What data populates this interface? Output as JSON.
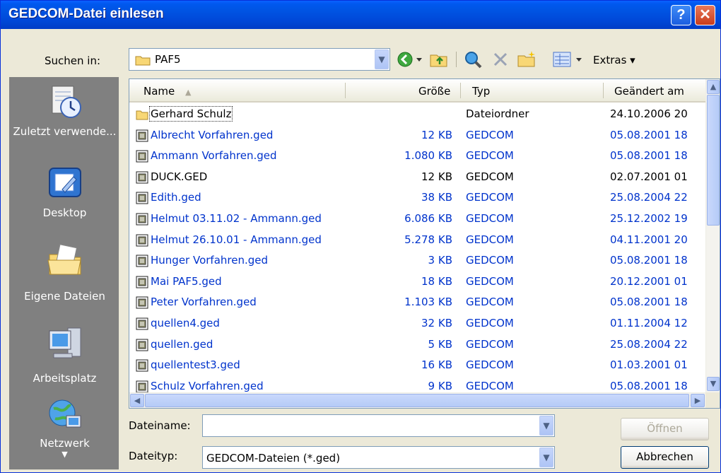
{
  "window": {
    "title": "GEDCOM-Datei einlesen",
    "help_glyph": "?",
    "close_glyph": "✕"
  },
  "lookin": {
    "label": "Suchen in:",
    "value": "PAF5"
  },
  "toolbar": {
    "extras_label": "Extras ▾"
  },
  "places": [
    {
      "label": "Zuletzt verwende...",
      "icon": "recent-documents-icon"
    },
    {
      "label": "Desktop",
      "icon": "desktop-icon"
    },
    {
      "label": "Eigene Dateien",
      "icon": "my-documents-icon"
    },
    {
      "label": "Arbeitsplatz",
      "icon": "my-computer-icon"
    },
    {
      "label": "Netzwerk",
      "icon": "network-icon"
    }
  ],
  "columns": {
    "name": "Name",
    "size": "Größe",
    "type": "Typ",
    "modified": "Geändert am"
  },
  "files": [
    {
      "name": "Gerhard Schulz",
      "size": "",
      "type": "Dateiordner",
      "modified": "24.10.2006 20",
      "kind": "folder",
      "color": "black"
    },
    {
      "name": "Albrecht Vorfahren.ged",
      "size": "12 KB",
      "type": "GEDCOM",
      "modified": "05.08.2001 18",
      "kind": "file",
      "color": "blue"
    },
    {
      "name": "Ammann Vorfahren.ged",
      "size": "1.080 KB",
      "type": "GEDCOM",
      "modified": "05.08.2001 18",
      "kind": "file",
      "color": "blue"
    },
    {
      "name": "DUCK.GED",
      "size": "12 KB",
      "type": "GEDCOM",
      "modified": "02.07.2001 01",
      "kind": "file",
      "color": "black"
    },
    {
      "name": "Edith.ged",
      "size": "38 KB",
      "type": "GEDCOM",
      "modified": "25.08.2004 22",
      "kind": "file",
      "color": "blue"
    },
    {
      "name": "Helmut 03.11.02 - Ammann.ged",
      "size": "6.086 KB",
      "type": "GEDCOM",
      "modified": "25.12.2002 19",
      "kind": "file",
      "color": "blue"
    },
    {
      "name": "Helmut 26.10.01 - Ammann.ged",
      "size": "5.278 KB",
      "type": "GEDCOM",
      "modified": "04.11.2001 20",
      "kind": "file",
      "color": "blue"
    },
    {
      "name": "Hunger Vorfahren.ged",
      "size": "3 KB",
      "type": "GEDCOM",
      "modified": "05.08.2001 18",
      "kind": "file",
      "color": "blue"
    },
    {
      "name": "Mai PAF5.ged",
      "size": "18 KB",
      "type": "GEDCOM",
      "modified": "20.12.2001 01",
      "kind": "file",
      "color": "blue"
    },
    {
      "name": "Peter Vorfahren.ged",
      "size": "1.103 KB",
      "type": "GEDCOM",
      "modified": "05.08.2001 18",
      "kind": "file",
      "color": "blue"
    },
    {
      "name": "quellen4.ged",
      "size": "32 KB",
      "type": "GEDCOM",
      "modified": "01.11.2004 12",
      "kind": "file",
      "color": "blue"
    },
    {
      "name": "quellen.ged",
      "size": "5 KB",
      "type": "GEDCOM",
      "modified": "25.08.2004 22",
      "kind": "file",
      "color": "blue"
    },
    {
      "name": "quellentest3.ged",
      "size": "16 KB",
      "type": "GEDCOM",
      "modified": "01.03.2001 01",
      "kind": "file",
      "color": "blue"
    },
    {
      "name": "Schulz Vorfahren.ged",
      "size": "9 KB",
      "type": "GEDCOM",
      "modified": "05.08.2001 18",
      "kind": "file",
      "color": "blue"
    }
  ],
  "filename": {
    "label": "Dateiname:",
    "value": ""
  },
  "filetype": {
    "label": "Dateityp:",
    "value": "GEDCOM-Dateien (*.ged)"
  },
  "buttons": {
    "open": "Öffnen",
    "cancel": "Abbrechen"
  },
  "colors": {
    "titlebar": "#0054e3",
    "link_blue": "#0033cc",
    "places_bg": "#808080",
    "dialog_bg": "#ece9d8"
  }
}
